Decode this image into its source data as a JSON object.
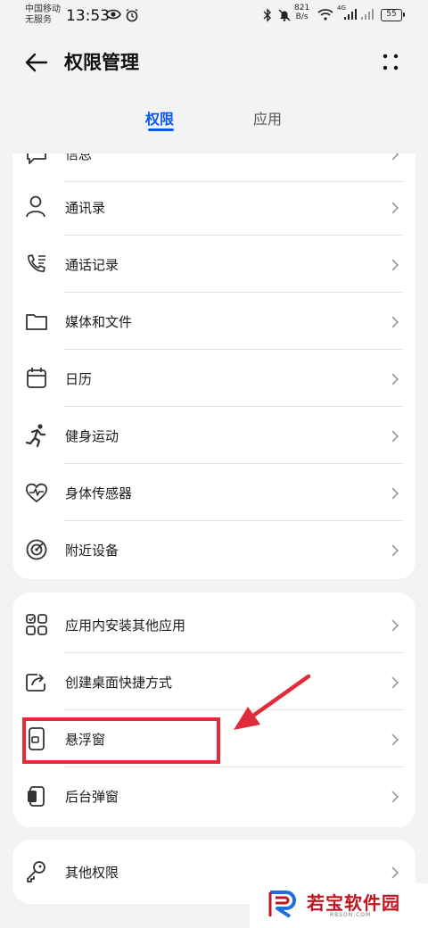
{
  "status_bar": {
    "carrier_line1": "中国移动",
    "carrier_line2": "无服务",
    "time": "13:53",
    "net_speed_value": "821",
    "net_speed_unit": "B/s",
    "battery": "55",
    "signal_label": "4G"
  },
  "header": {
    "title": "权限管理"
  },
  "tabs": [
    {
      "label": "权限",
      "active": true
    },
    {
      "label": "应用",
      "active": false
    }
  ],
  "permissions": {
    "partial_label": "信息",
    "items": [
      {
        "label": "通讯录",
        "icon": "contacts-icon"
      },
      {
        "label": "通话记录",
        "icon": "call-log-icon"
      },
      {
        "label": "媒体和文件",
        "icon": "folder-icon"
      },
      {
        "label": "日历",
        "icon": "calendar-icon"
      },
      {
        "label": "健身运动",
        "icon": "running-icon"
      },
      {
        "label": "身体传感器",
        "icon": "heart-rate-icon"
      },
      {
        "label": "附近设备",
        "icon": "radar-icon"
      }
    ]
  },
  "special_permissions": {
    "items": [
      {
        "label": "应用内安装其他应用",
        "icon": "app-grid-icon"
      },
      {
        "label": "创建桌面快捷方式",
        "icon": "shortcut-icon"
      },
      {
        "label": "悬浮窗",
        "icon": "floating-window-icon"
      },
      {
        "label": "后台弹窗",
        "icon": "background-popup-icon"
      }
    ]
  },
  "other": {
    "items": [
      {
        "label": "其他权限",
        "icon": "key-icon"
      }
    ]
  },
  "annotation": {
    "highlight_color": "#e02b3a"
  },
  "watermark": {
    "name": "若宝软件园",
    "url": "RBSON.COM"
  },
  "colors": {
    "accent": "#0a59f7",
    "background": "#f1f3f5",
    "card": "#ffffff"
  }
}
